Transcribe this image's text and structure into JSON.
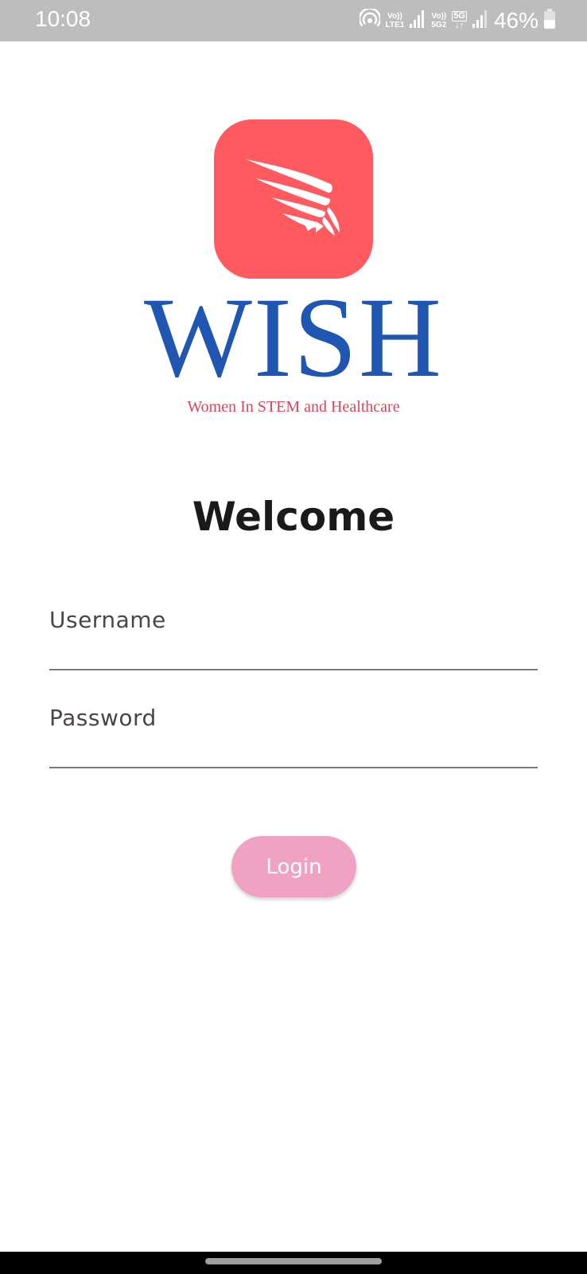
{
  "status_bar": {
    "time": "10:08",
    "hotspot_icon": "hotspot-icon",
    "sim1_label_top": "Vo))",
    "sim1_label_bottom": "LTE1",
    "sim2_label_top": "Vo))",
    "sim2_label_bottom": "5G2",
    "network_type": "5G",
    "battery_percent": "46%"
  },
  "brand": {
    "logo_icon": "wing-icon",
    "logo_color": "#fe5a60",
    "wordmark": "WISH",
    "wordmark_color": "#1f56b1",
    "tagline": "Women In STEM and Healthcare",
    "tagline_color": "#d9465b"
  },
  "login": {
    "title": "Welcome",
    "username_label": "Username",
    "password_label": "Password",
    "button_label": "Login",
    "button_color": "#f0a2c2"
  }
}
